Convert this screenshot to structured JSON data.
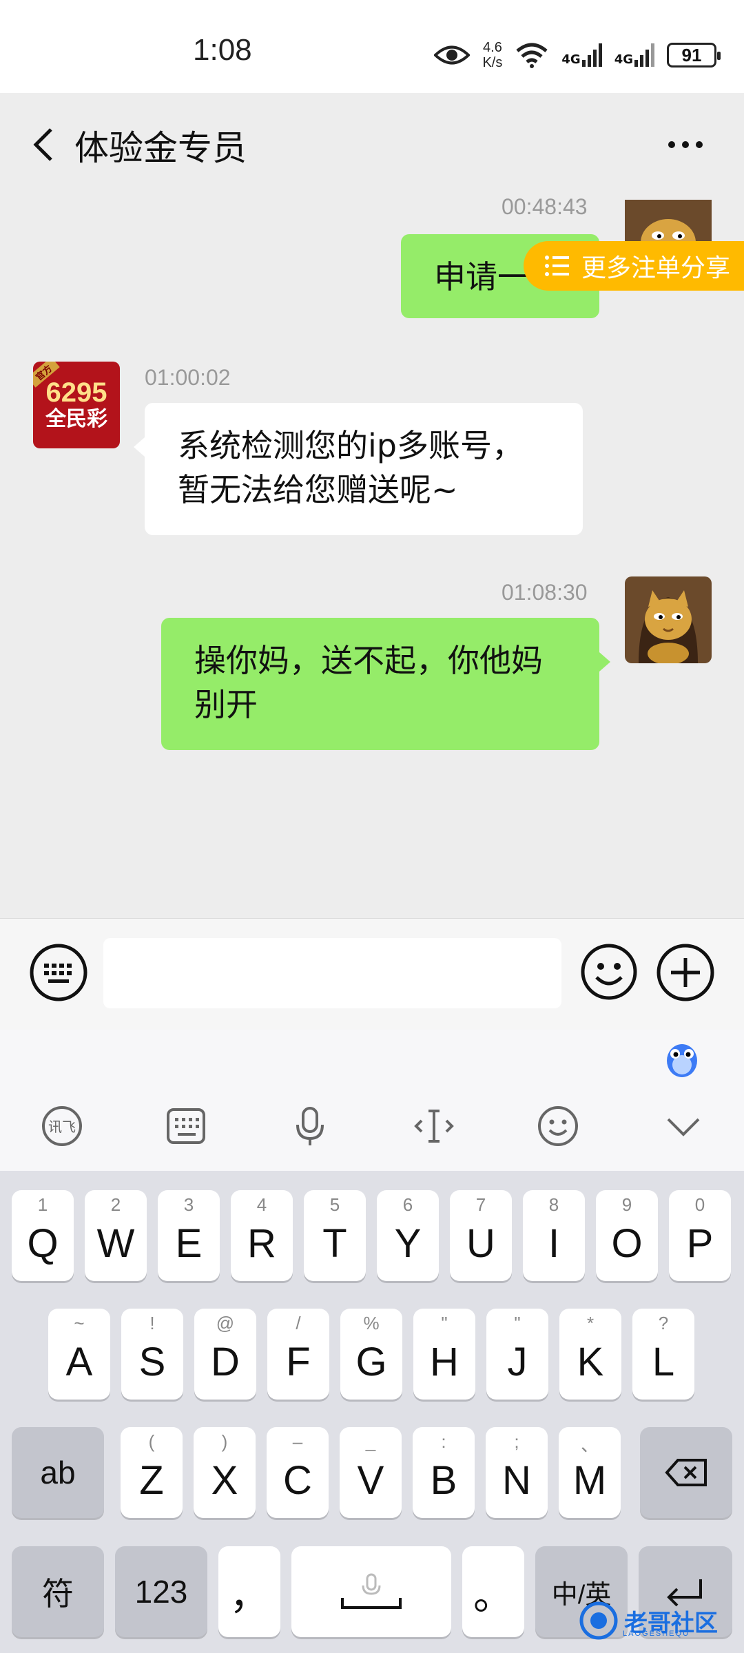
{
  "status_bar": {
    "time": "1:08",
    "net_speed_value": "4.6",
    "net_speed_unit": "K/s",
    "signal_label_1": "4G",
    "signal_label_2": "4G",
    "battery": "91"
  },
  "header": {
    "title": "体验金专员"
  },
  "floating_tag": {
    "label": "更多注单分享",
    "color": "#ffba00"
  },
  "messages": [
    {
      "sender": "me",
      "time": "00:48:43",
      "text": "申请一"
    },
    {
      "sender": "them",
      "time": "01:00:02",
      "text_line1": "系统检测您的ip多账号，",
      "text_line2": "暂无法给您赠送呢~"
    },
    {
      "sender": "me",
      "time": "01:08:30",
      "text_line1": "操你妈，送不起，你他妈",
      "text_line2": "别开"
    }
  ],
  "contact_logo": {
    "ribbon": "官方",
    "number": "6295",
    "name": "全民彩"
  },
  "input": {
    "value": "",
    "placeholder": ""
  },
  "keyboard": {
    "row1": [
      {
        "hint": "1",
        "key": "Q"
      },
      {
        "hint": "2",
        "key": "W"
      },
      {
        "hint": "3",
        "key": "E"
      },
      {
        "hint": "4",
        "key": "R"
      },
      {
        "hint": "5",
        "key": "T"
      },
      {
        "hint": "6",
        "key": "Y"
      },
      {
        "hint": "7",
        "key": "U"
      },
      {
        "hint": "8",
        "key": "I"
      },
      {
        "hint": "9",
        "key": "O"
      },
      {
        "hint": "0",
        "key": "P"
      }
    ],
    "row2": [
      {
        "hint": "~",
        "key": "A"
      },
      {
        "hint": "!",
        "key": "S"
      },
      {
        "hint": "@",
        "key": "D"
      },
      {
        "hint": "/",
        "key": "F"
      },
      {
        "hint": "%",
        "key": "G"
      },
      {
        "hint": "\"",
        "key": "H"
      },
      {
        "hint": "\"",
        "key": "J"
      },
      {
        "hint": "*",
        "key": "K"
      },
      {
        "hint": "?",
        "key": "L"
      }
    ],
    "row3": [
      {
        "hint": "(",
        "key": "Z"
      },
      {
        "hint": ")",
        "key": "X"
      },
      {
        "hint": "–",
        "key": "C"
      },
      {
        "hint": "_",
        "key": "V"
      },
      {
        "hint": ":",
        "key": "B"
      },
      {
        "hint": ";",
        "key": "N"
      },
      {
        "hint": "、",
        "key": "M"
      }
    ],
    "shift_label": "ab",
    "symbol_label": "符",
    "numbers_label": "123",
    "comma_label": "，",
    "period_label": "。",
    "lang_label": "中/英"
  },
  "watermark": {
    "text": "老哥社区",
    "sub": "LAOGESHEQU"
  },
  "colors": {
    "my_bubble": "#95ec69",
    "their_bubble": "#ffffff",
    "background": "#ededed"
  },
  "icons": [
    "eye-icon",
    "wifi-icon",
    "back-icon",
    "more-icon",
    "keyboard-icon",
    "emoji-icon",
    "plus-icon",
    "xunfei-icon",
    "keyboard-layout-icon",
    "mic-icon",
    "cursor-icon",
    "smiley-icon",
    "collapse-icon",
    "backspace-icon",
    "enter-icon"
  ]
}
